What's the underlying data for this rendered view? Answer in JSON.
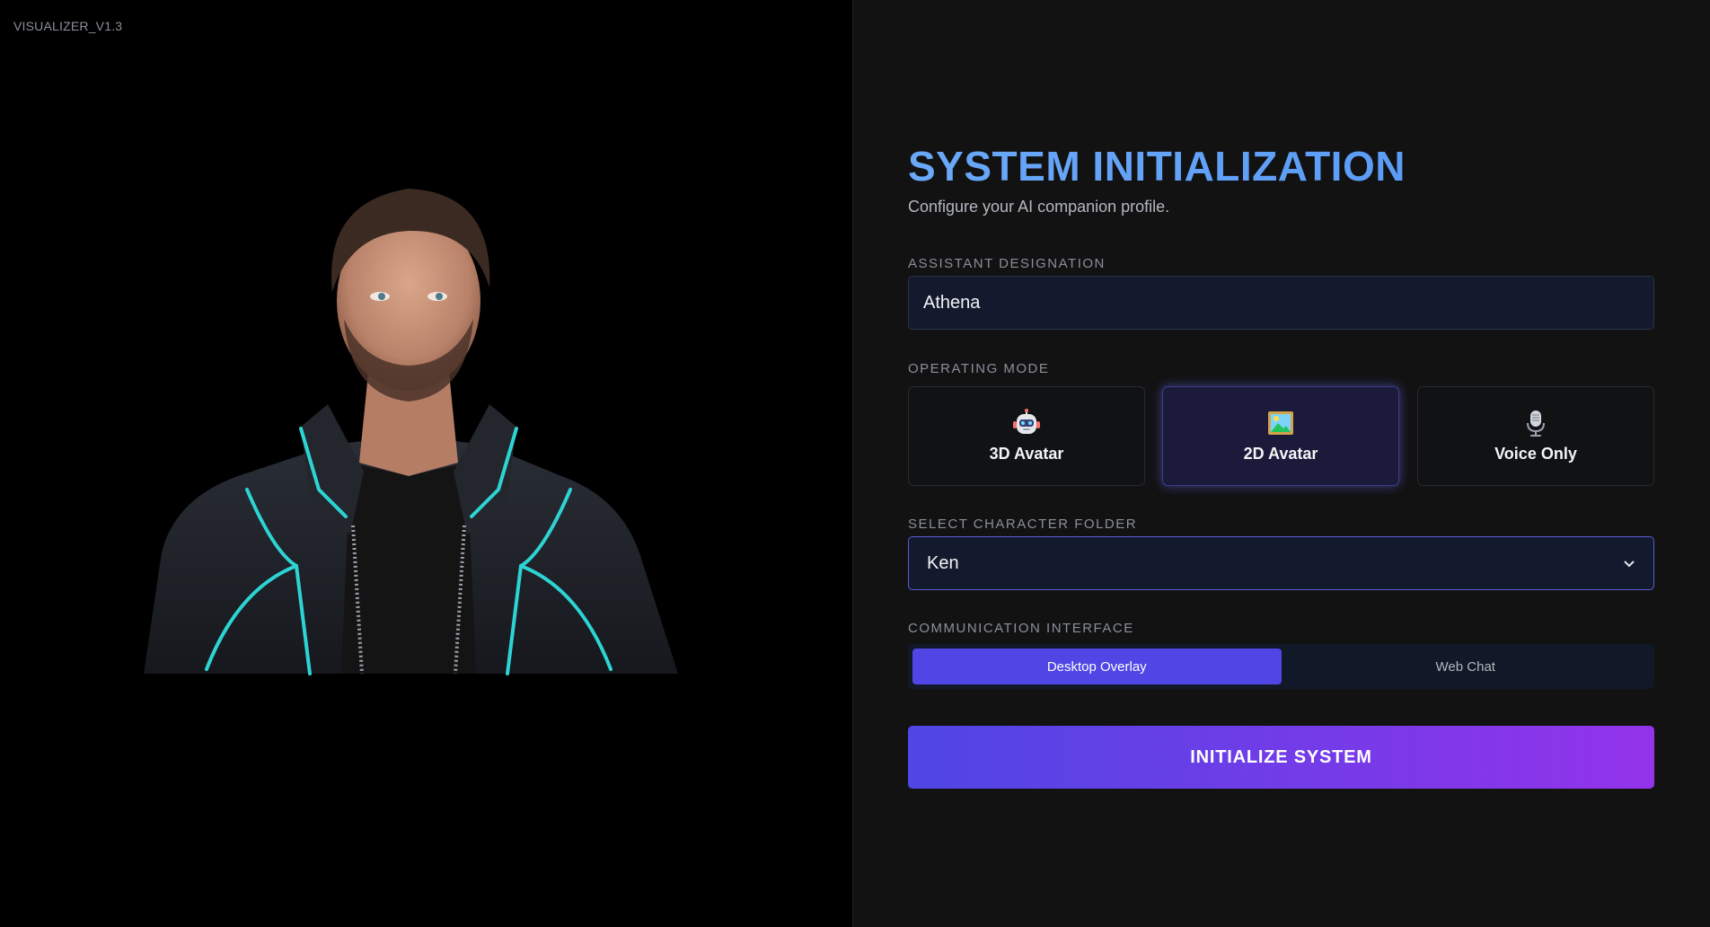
{
  "version_label": "VISUALIZER_V1.3",
  "title": "SYSTEM INITIALIZATION",
  "subtitle": "Configure your AI companion profile.",
  "designation": {
    "label": "ASSISTANT DESIGNATION",
    "value": "Athena"
  },
  "mode": {
    "label": "OPERATING MODE",
    "options": [
      {
        "label": "3D Avatar",
        "icon": "robot-icon",
        "selected": false
      },
      {
        "label": "2D Avatar",
        "icon": "framed-picture-icon",
        "selected": true
      },
      {
        "label": "Voice Only",
        "icon": "microphone-icon",
        "selected": false
      }
    ]
  },
  "character": {
    "label": "SELECT CHARACTER FOLDER",
    "value": "Ken"
  },
  "interface": {
    "label": "COMMUNICATION INTERFACE",
    "options": [
      {
        "label": "Desktop Overlay",
        "selected": true
      },
      {
        "label": "Web Chat",
        "selected": false
      }
    ]
  },
  "submit_label": "INITIALIZE SYSTEM",
  "colors": {
    "accent": "#4f46e5",
    "accent_end": "#9333ea",
    "title": "#60a5fa",
    "jacket_trim": "#2dd4d4"
  }
}
